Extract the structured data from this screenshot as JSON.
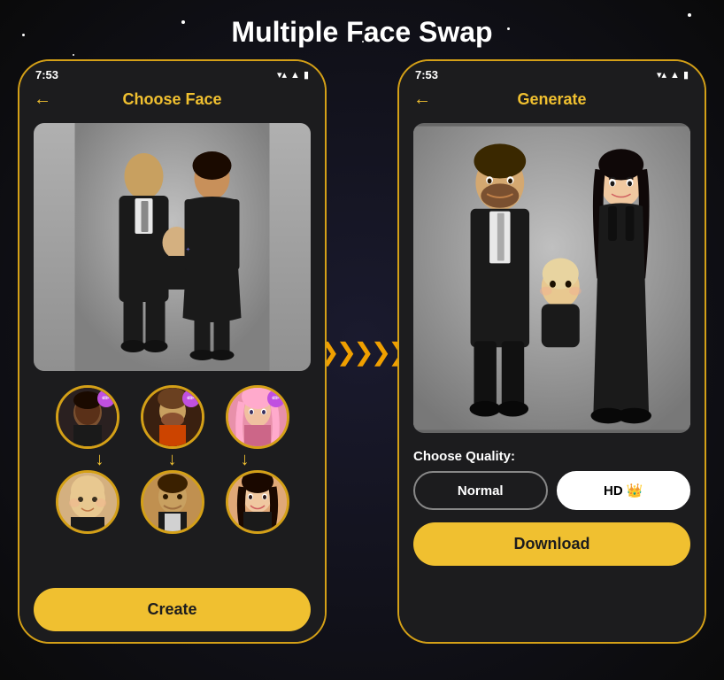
{
  "page": {
    "title": "Multiple Face Swap",
    "background_color": "#0a0a0a"
  },
  "left_phone": {
    "status_time": "7:53",
    "title": "Choose Face",
    "back_label": "←",
    "face_sources": [
      {
        "id": "face-src-1",
        "emoji": "👤",
        "color": "#3a3030"
      },
      {
        "id": "face-src-2",
        "emoji": "👤",
        "color": "#4a3a20"
      },
      {
        "id": "face-src-3",
        "emoji": "👤",
        "color": "#e899aa"
      }
    ],
    "face_targets": [
      {
        "id": "face-tgt-1",
        "emoji": "👶",
        "color": "#d4b080"
      },
      {
        "id": "face-tgt-2",
        "emoji": "👤",
        "color": "#c09050"
      },
      {
        "id": "face-tgt-3",
        "emoji": "👤",
        "color": "#e0a878"
      }
    ],
    "create_button": "Create",
    "arrow_down": "↓"
  },
  "right_phone": {
    "status_time": "7:53",
    "title": "Generate",
    "back_label": "←",
    "quality_label": "Choose Quality:",
    "quality_options": [
      {
        "id": "normal",
        "label": "Normal",
        "active": false
      },
      {
        "id": "hd",
        "label": "HD 👑",
        "active": true
      }
    ],
    "download_button": "Download"
  },
  "arrow_between": "❯❯❯❯❯",
  "icons": {
    "edit": "✏",
    "signal": "▲",
    "wifi": "▲",
    "battery": "▮"
  }
}
